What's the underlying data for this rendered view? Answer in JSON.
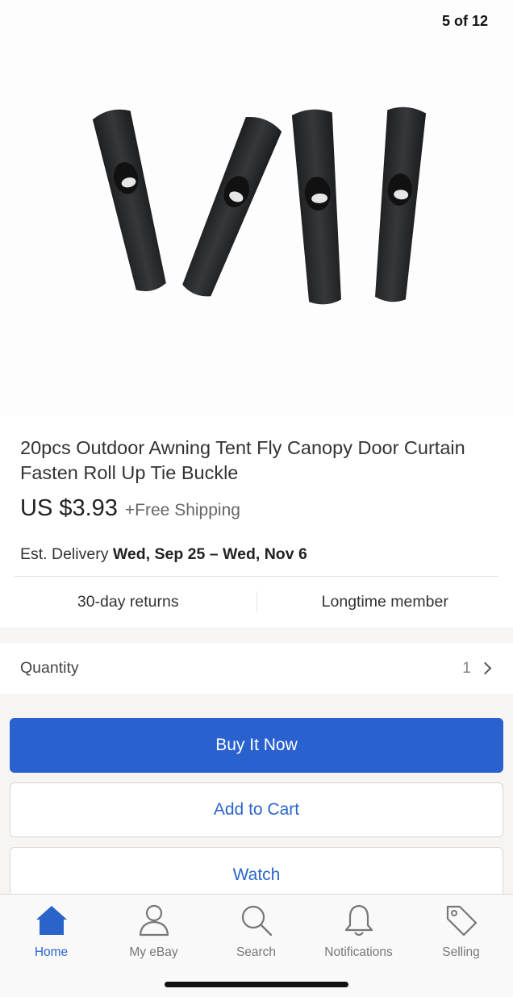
{
  "gallery": {
    "counter": "5 of 12"
  },
  "product": {
    "title": "20pcs Outdoor Awning Tent Fly Canopy Door Curtain Fasten Roll Up Tie Buckle",
    "price": "US $3.93",
    "shipping": "+Free Shipping",
    "delivery_prefix": "Est. Delivery ",
    "delivery_dates": "Wed, Sep 25 – Wed, Nov 6"
  },
  "perks": {
    "returns": "30-day returns",
    "seller": "Longtime member"
  },
  "quantity": {
    "label": "Quantity",
    "value": "1"
  },
  "actions": {
    "buy": "Buy It Now",
    "cart": "Add to Cart",
    "watch": "Watch"
  },
  "tabbar": {
    "items": [
      {
        "label": "Home",
        "icon": "home-icon",
        "active": true
      },
      {
        "label": "My eBay",
        "icon": "person-icon",
        "active": false
      },
      {
        "label": "Search",
        "icon": "search-icon",
        "active": false
      },
      {
        "label": "Notifications",
        "icon": "bell-icon",
        "active": false
      },
      {
        "label": "Selling",
        "icon": "tag-icon",
        "active": false
      }
    ]
  },
  "colors": {
    "accent": "#2961cf",
    "link": "#2b66c9",
    "toggle_fill": "#2a2c2e"
  }
}
